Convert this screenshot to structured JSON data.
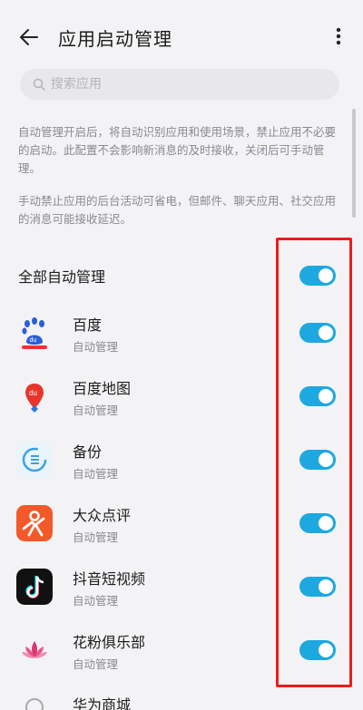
{
  "header": {
    "title": "应用启动管理",
    "back_icon": "arrow-left-icon",
    "more_icon": "more-vertical-icon"
  },
  "search": {
    "placeholder": "搜索应用",
    "value": ""
  },
  "description": {
    "para1": "自动管理开启后，将自动识别应用和使用场景，禁止应用不必要的启动。此配置不会影响新消息的及时接收，关闭后可手动管理。",
    "para2": "手动禁止应用的后台活动可省电，但邮件、聊天应用、社交应用的消息可能接收延迟。"
  },
  "all_auto": {
    "label": "全部自动管理",
    "enabled": true
  },
  "apps": [
    {
      "name": "百度",
      "status": "自动管理",
      "icon": "baidu-icon",
      "enabled": true
    },
    {
      "name": "百度地图",
      "status": "自动管理",
      "icon": "baidu-map-icon",
      "enabled": true
    },
    {
      "name": "备份",
      "status": "自动管理",
      "icon": "backup-icon",
      "enabled": true
    },
    {
      "name": "大众点评",
      "status": "自动管理",
      "icon": "dianping-icon",
      "enabled": true
    },
    {
      "name": "抖音短视频",
      "status": "自动管理",
      "icon": "douyin-icon",
      "enabled": true
    },
    {
      "name": "花粉俱乐部",
      "status": "自动管理",
      "icon": "huafen-icon",
      "enabled": true
    },
    {
      "name": "华为商城",
      "icon": "vmall-icon"
    }
  ],
  "colors": {
    "accent": "#1da8e0",
    "highlight": "#ee1b1b",
    "background": "#f3f3f5"
  }
}
